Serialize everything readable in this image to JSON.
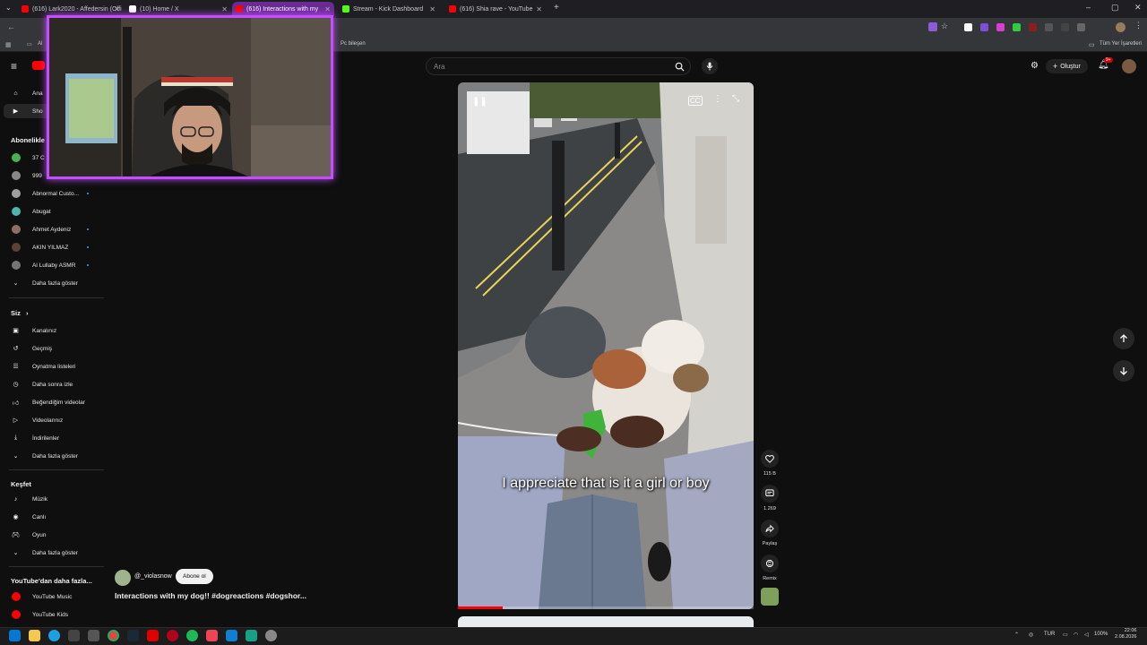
{
  "browser": {
    "tabs": [
      {
        "title": "(616) Lark2020 - Affedersin (Offi",
        "color": "#ff0000"
      },
      {
        "title": "(10) Home / X",
        "color": "#ffffff"
      },
      {
        "title": "(616) Interactions with my",
        "color": "#ff0000",
        "active": true
      },
      {
        "title": "Stream - Kick Dashboard",
        "color": "#53fc18"
      },
      {
        "title": "(616) Shia rave - YouTube",
        "color": "#ff0000"
      }
    ],
    "new_tab_label": "+",
    "bookmark_left": "Al",
    "bookmark_pc": "Pc bileşen",
    "bookmark_right": "Tüm Yer İşaretleri"
  },
  "header": {
    "logo_text": "P",
    "search_placeholder": "Ara",
    "create_label": "Oluştur",
    "notif_badge": "9+"
  },
  "sidebar": {
    "top_items": [
      {
        "label": "Ana",
        "icon": "home-icon"
      },
      {
        "label": "Sho",
        "icon": "shorts-icon"
      }
    ],
    "subs_heading": "Abonelikle",
    "subscriptions": [
      {
        "label": "37 C",
        "color": "#4caf50",
        "dot": false
      },
      {
        "label": "999",
        "color": "#888888",
        "dot": false
      },
      {
        "label": "Abnormal Custo...",
        "color": "#9e9e9e",
        "dot": true
      },
      {
        "label": "Abugat",
        "color": "#4db6ac",
        "dot": false
      },
      {
        "label": "Ahmet Aydeniz",
        "color": "#8d6e63",
        "dot": true
      },
      {
        "label": "AKIN YILMAZ",
        "color": "#5d4037",
        "dot": true
      },
      {
        "label": "Al Lullaby ASMR",
        "color": "#757575",
        "dot": true
      }
    ],
    "subs_more": "Daha fazla göster",
    "you_heading": "Siz",
    "you_items": [
      {
        "label": "Kanalınız",
        "icon": "channel-icon"
      },
      {
        "label": "Geçmiş",
        "icon": "history-icon"
      },
      {
        "label": "Oynatma listeleri",
        "icon": "playlists-icon"
      },
      {
        "label": "Daha sonra izle",
        "icon": "watch-later-icon"
      },
      {
        "label": "Beğendiğim videolar",
        "icon": "liked-icon"
      },
      {
        "label": "Videolarınız",
        "icon": "your-videos-icon"
      },
      {
        "label": "İndirilenler",
        "icon": "downloads-icon"
      },
      {
        "label": "Daha fazla göster",
        "icon": "chevron-down-icon"
      }
    ],
    "explore_heading": "Keşfet",
    "explore_items": [
      {
        "label": "Müzik",
        "icon": "music-icon"
      },
      {
        "label": "Canlı",
        "icon": "live-icon"
      },
      {
        "label": "Oyun",
        "icon": "gaming-icon"
      },
      {
        "label": "Daha fazla göster",
        "icon": "chevron-down-icon"
      }
    ],
    "more_heading": "YouTube'dan daha fazla...",
    "more_items": [
      {
        "label": "YouTube Music"
      },
      {
        "label": "YouTube Kids"
      }
    ]
  },
  "video": {
    "caption": "I appreciate that is it a girl or boy",
    "progress": 0.15
  },
  "actions": {
    "likes": "115 B",
    "comments": "1.269",
    "share": "Paylaş",
    "remix": "Remix"
  },
  "channel": {
    "name": "@_violasnow",
    "subscribe": "Abone ol",
    "title": "Interactions with my dog!! #dogreactions #dogshor..."
  },
  "taskbar": {
    "lang": "TUR",
    "battery": "100%",
    "time": "22:06",
    "date": "2.08.2026"
  }
}
